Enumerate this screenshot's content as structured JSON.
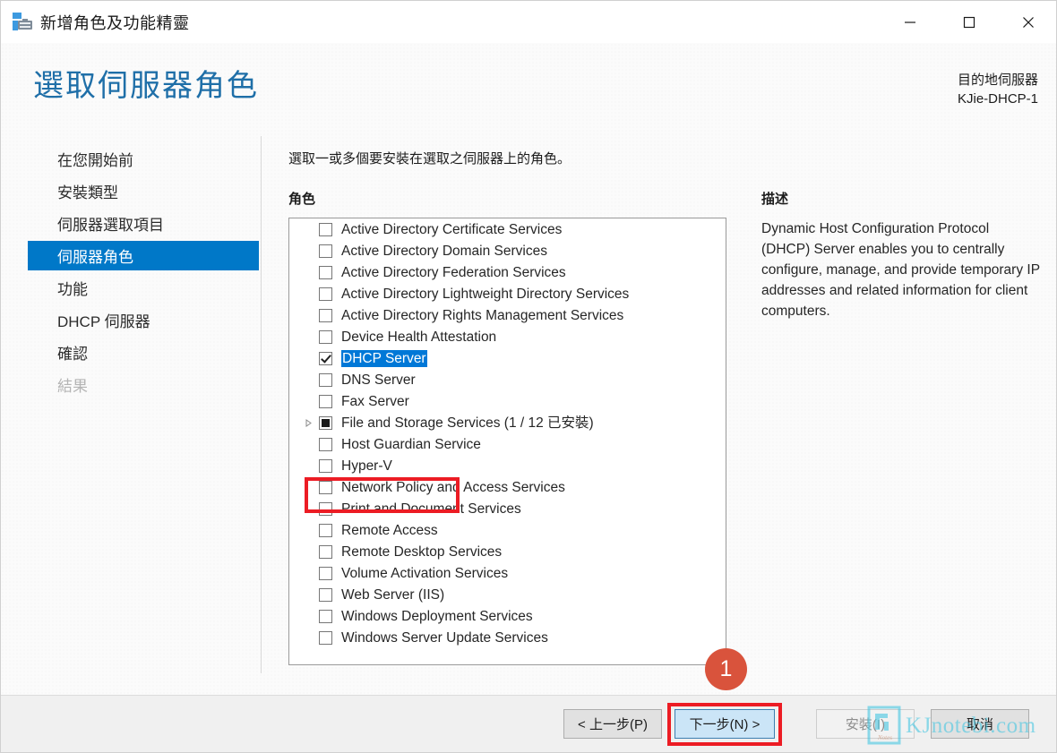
{
  "window": {
    "title": "新增角色及功能精靈",
    "icon": "server-wizard-icon",
    "minimize_label": "最小化",
    "maximize_label": "最大化",
    "close_label": "關閉"
  },
  "header": {
    "page_title": "選取伺服器角色",
    "destination_label": "目的地伺服器",
    "destination_server": "KJie-DHCP-1"
  },
  "sidebar": {
    "items": [
      {
        "label": "在您開始前",
        "state": "normal"
      },
      {
        "label": "安裝類型",
        "state": "normal"
      },
      {
        "label": "伺服器選取項目",
        "state": "normal"
      },
      {
        "label": "伺服器角色",
        "state": "selected"
      },
      {
        "label": "功能",
        "state": "normal"
      },
      {
        "label": "DHCP 伺服器",
        "state": "normal"
      },
      {
        "label": "確認",
        "state": "normal"
      },
      {
        "label": "結果",
        "state": "disabled"
      }
    ]
  },
  "main": {
    "intro": "選取一或多個要安裝在選取之伺服器上的角色。",
    "roles_label": "角色",
    "description_label": "描述",
    "description_text": "Dynamic Host Configuration Protocol (DHCP) Server enables you to centrally configure, manage, and provide temporary IP addresses and related information for client computers.",
    "roles": [
      {
        "label": "Active Directory Certificate Services",
        "checked": "unchecked",
        "expandable": false,
        "selected": false
      },
      {
        "label": "Active Directory Domain Services",
        "checked": "unchecked",
        "expandable": false,
        "selected": false
      },
      {
        "label": "Active Directory Federation Services",
        "checked": "unchecked",
        "expandable": false,
        "selected": false
      },
      {
        "label": "Active Directory Lightweight Directory Services",
        "checked": "unchecked",
        "expandable": false,
        "selected": false
      },
      {
        "label": "Active Directory Rights Management Services",
        "checked": "unchecked",
        "expandable": false,
        "selected": false
      },
      {
        "label": "Device Health Attestation",
        "checked": "unchecked",
        "expandable": false,
        "selected": false
      },
      {
        "label": "DHCP Server",
        "checked": "checked",
        "expandable": false,
        "selected": true
      },
      {
        "label": "DNS Server",
        "checked": "unchecked",
        "expandable": false,
        "selected": false
      },
      {
        "label": "Fax Server",
        "checked": "unchecked",
        "expandable": false,
        "selected": false
      },
      {
        "label": "File and Storage Services (1 / 12 已安裝)",
        "checked": "partial",
        "expandable": true,
        "selected": false
      },
      {
        "label": "Host Guardian Service",
        "checked": "unchecked",
        "expandable": false,
        "selected": false
      },
      {
        "label": "Hyper-V",
        "checked": "unchecked",
        "expandable": false,
        "selected": false
      },
      {
        "label": "Network Policy and Access Services",
        "checked": "unchecked",
        "expandable": false,
        "selected": false
      },
      {
        "label": "Print and Document Services",
        "checked": "unchecked",
        "expandable": false,
        "selected": false
      },
      {
        "label": "Remote Access",
        "checked": "unchecked",
        "expandable": false,
        "selected": false
      },
      {
        "label": "Remote Desktop Services",
        "checked": "unchecked",
        "expandable": false,
        "selected": false
      },
      {
        "label": "Volume Activation Services",
        "checked": "unchecked",
        "expandable": false,
        "selected": false
      },
      {
        "label": "Web Server (IIS)",
        "checked": "unchecked",
        "expandable": false,
        "selected": false
      },
      {
        "label": "Windows Deployment Services",
        "checked": "unchecked",
        "expandable": false,
        "selected": false
      },
      {
        "label": "Windows Server Update Services",
        "checked": "unchecked",
        "expandable": false,
        "selected": false
      }
    ]
  },
  "footer": {
    "back": "< 上一步(P)",
    "next": "下一步(N) >",
    "install": "安裝(I)",
    "cancel": "取消"
  },
  "annotations": {
    "step_badge": "1",
    "badge_color": "#d9533c",
    "box_color": "#ec1c24"
  },
  "watermark": {
    "text": "KJnotebi.com",
    "color": "#4cc8e2"
  }
}
